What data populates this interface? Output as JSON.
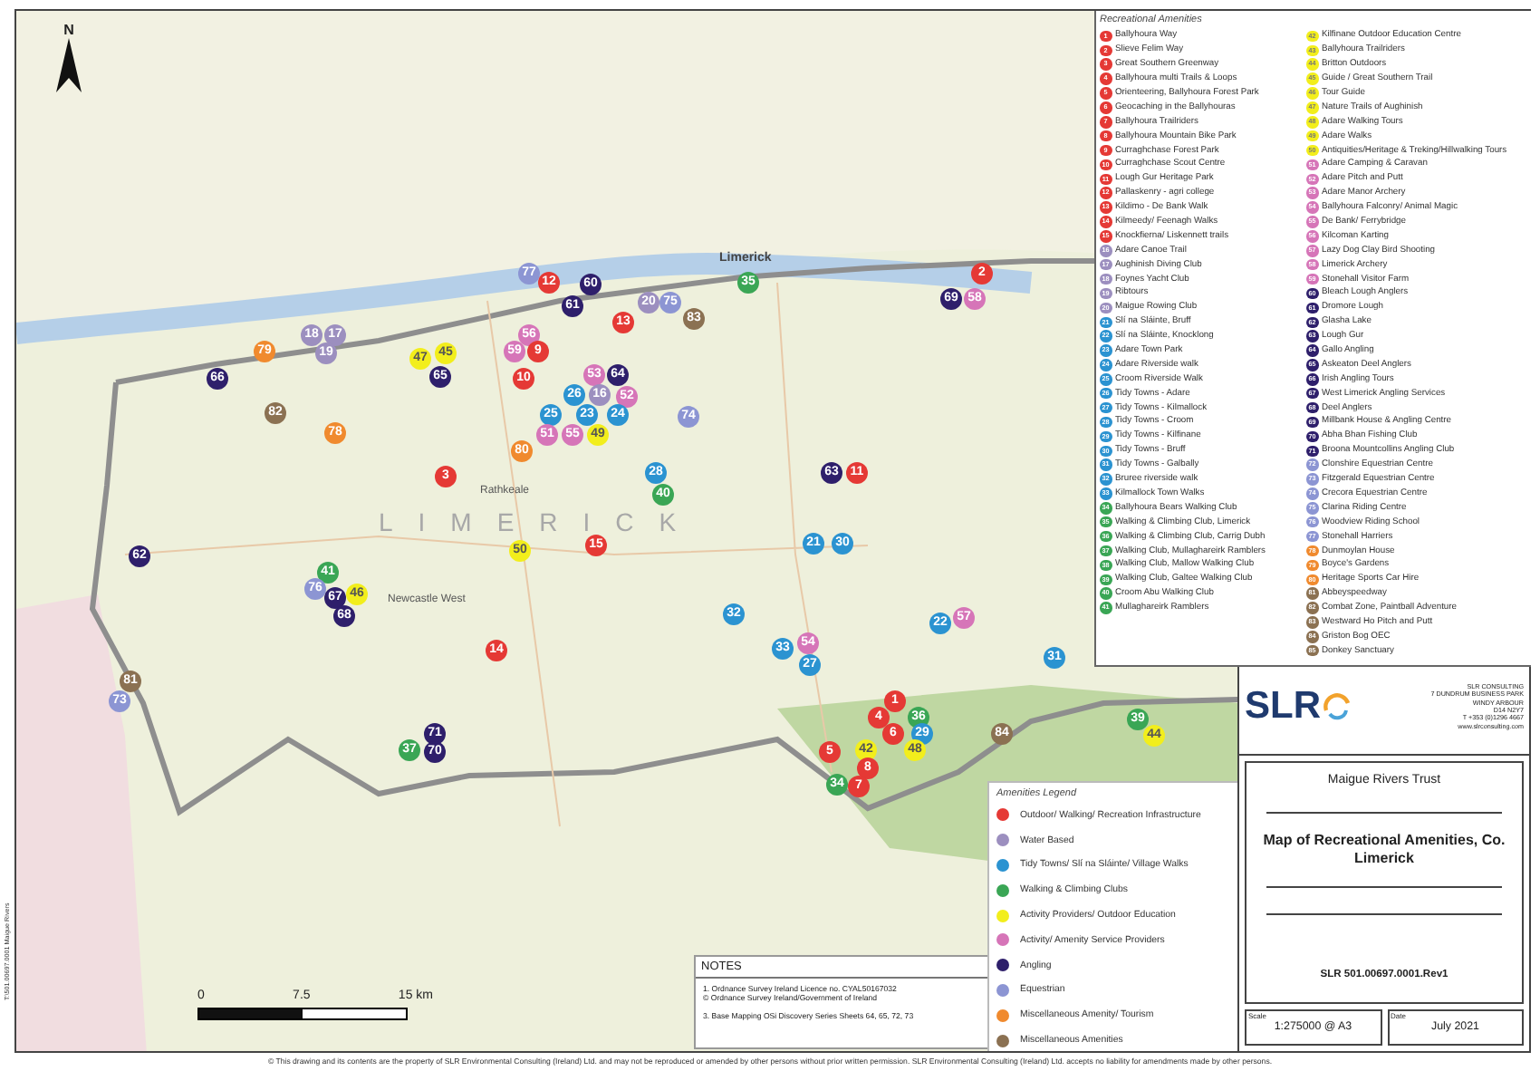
{
  "map": {
    "north_label": "N",
    "county_label": "LIMERICK",
    "places": [
      "Limerick",
      "Rathkeale",
      "Newcastle West"
    ],
    "pins": [
      {
        "label": "77",
        "color": "#8c95d3"
      },
      {
        "label": "12",
        "color": "#e53935"
      },
      {
        "label": "60",
        "color": "#2e1f6b"
      },
      {
        "label": "35",
        "color": "#3aa655"
      },
      {
        "label": "2",
        "color": "#e53935"
      },
      {
        "label": "61",
        "color": "#2e1f6b"
      },
      {
        "label": "20",
        "color": "#9c8fbf"
      },
      {
        "label": "75",
        "color": "#8c95d3"
      },
      {
        "label": "69",
        "color": "#2e1f6b"
      },
      {
        "label": "58",
        "color": "#d675b8"
      },
      {
        "label": "18",
        "color": "#9c8fbf"
      },
      {
        "label": "17",
        "color": "#9c8fbf"
      },
      {
        "label": "56",
        "color": "#d675b8"
      },
      {
        "label": "13",
        "color": "#e53935"
      },
      {
        "label": "83",
        "color": "#8b7152"
      },
      {
        "label": "79",
        "color": "#f08a2e"
      },
      {
        "label": "19",
        "color": "#9c8fbf"
      },
      {
        "label": "47",
        "color": "#f2ee1c"
      },
      {
        "label": "45",
        "color": "#f2ee1c"
      },
      {
        "label": "59",
        "color": "#d675b8"
      },
      {
        "label": "9",
        "color": "#e53935"
      },
      {
        "label": "66",
        "color": "#2e1f6b"
      },
      {
        "label": "65",
        "color": "#2e1f6b"
      },
      {
        "label": "10",
        "color": "#e53935"
      },
      {
        "label": "53",
        "color": "#d675b8"
      },
      {
        "label": "64",
        "color": "#2e1f6b"
      },
      {
        "label": "26",
        "color": "#2b93d1"
      },
      {
        "label": "16",
        "color": "#9c8fbf"
      },
      {
        "label": "52",
        "color": "#d675b8"
      },
      {
        "label": "82",
        "color": "#8b7152"
      },
      {
        "label": "25",
        "color": "#2b93d1"
      },
      {
        "label": "23",
        "color": "#2b93d1"
      },
      {
        "label": "24",
        "color": "#2b93d1"
      },
      {
        "label": "74",
        "color": "#8c95d3"
      },
      {
        "label": "78",
        "color": "#f08a2e"
      },
      {
        "label": "51",
        "color": "#d675b8"
      },
      {
        "label": "55",
        "color": "#d675b8"
      },
      {
        "label": "49",
        "color": "#f2ee1c"
      },
      {
        "label": "80",
        "color": "#f08a2e"
      },
      {
        "label": "3",
        "color": "#e53935"
      },
      {
        "label": "28",
        "color": "#2b93d1"
      },
      {
        "label": "63",
        "color": "#2e1f6b"
      },
      {
        "label": "11",
        "color": "#e53935"
      },
      {
        "label": "40",
        "color": "#3aa655"
      },
      {
        "label": "62",
        "color": "#2e1f6b"
      },
      {
        "label": "50",
        "color": "#f2ee1c"
      },
      {
        "label": "15",
        "color": "#e53935"
      },
      {
        "label": "21",
        "color": "#2b93d1"
      },
      {
        "label": "30",
        "color": "#2b93d1"
      },
      {
        "label": "41",
        "color": "#3aa655"
      },
      {
        "label": "76",
        "color": "#8c95d3"
      },
      {
        "label": "67",
        "color": "#2e1f6b"
      },
      {
        "label": "46",
        "color": "#f2ee1c"
      },
      {
        "label": "68",
        "color": "#2e1f6b"
      },
      {
        "label": "32",
        "color": "#2b93d1"
      },
      {
        "label": "22",
        "color": "#2b93d1"
      },
      {
        "label": "57",
        "color": "#d675b8"
      },
      {
        "label": "14",
        "color": "#e53935"
      },
      {
        "label": "33",
        "color": "#2b93d1"
      },
      {
        "label": "54",
        "color": "#d675b8"
      },
      {
        "label": "27",
        "color": "#2b93d1"
      },
      {
        "label": "31",
        "color": "#2b93d1"
      },
      {
        "label": "81",
        "color": "#8b7152"
      },
      {
        "label": "73",
        "color": "#8c95d3"
      },
      {
        "label": "1",
        "color": "#e53935"
      },
      {
        "label": "4",
        "color": "#e53935"
      },
      {
        "label": "36",
        "color": "#3aa655"
      },
      {
        "label": "39",
        "color": "#3aa655"
      },
      {
        "label": "71",
        "color": "#2e1f6b"
      },
      {
        "label": "6",
        "color": "#e53935"
      },
      {
        "label": "29",
        "color": "#2b93d1"
      },
      {
        "label": "84",
        "color": "#8b7152"
      },
      {
        "label": "44",
        "color": "#f2ee1c"
      },
      {
        "label": "37",
        "color": "#3aa655"
      },
      {
        "label": "70",
        "color": "#2e1f6b"
      },
      {
        "label": "5",
        "color": "#e53935"
      },
      {
        "label": "42",
        "color": "#f2ee1c"
      },
      {
        "label": "48",
        "color": "#f2ee1c"
      },
      {
        "label": "8",
        "color": "#e53935"
      },
      {
        "label": "34",
        "color": "#3aa655"
      },
      {
        "label": "7",
        "color": "#e53935"
      }
    ],
    "scale_labels": [
      "0",
      "7.5",
      "15 km"
    ]
  },
  "amenities": {
    "title": "Recreational Amenities",
    "items": [
      {
        "number": "1",
        "name": "Ballyhoura Way",
        "color": "#e53935"
      },
      {
        "number": "2",
        "name": "Slieve Felim Way",
        "color": "#e53935"
      },
      {
        "number": "3",
        "name": "Great Southern Greenway",
        "color": "#e53935"
      },
      {
        "number": "4",
        "name": "Ballyhoura multi Trails & Loops",
        "color": "#e53935"
      },
      {
        "number": "5",
        "name": "Orienteering, Ballyhoura Forest Park",
        "color": "#e53935"
      },
      {
        "number": "6",
        "name": "Geocaching in the Ballyhouras",
        "color": "#e53935"
      },
      {
        "number": "7",
        "name": "Ballyhoura Trailriders",
        "color": "#e53935"
      },
      {
        "number": "8",
        "name": "Ballyhoura Mountain Bike Park",
        "color": "#e53935"
      },
      {
        "number": "9",
        "name": "Curraghchase Forest Park",
        "color": "#e53935"
      },
      {
        "number": "10",
        "name": "Curraghchase Scout Centre",
        "color": "#e53935"
      },
      {
        "number": "11",
        "name": "Lough Gur Heritage Park",
        "color": "#e53935"
      },
      {
        "number": "12",
        "name": "Pallaskenry - agri college",
        "color": "#e53935"
      },
      {
        "number": "13",
        "name": "Kildimo - De Bank Walk",
        "color": "#e53935"
      },
      {
        "number": "14",
        "name": "Kilmeedy/ Feenagh Walks",
        "color": "#e53935"
      },
      {
        "number": "15",
        "name": "Knockfierna/ Liskennett trails",
        "color": "#e53935"
      },
      {
        "number": "16",
        "name": "Adare Canoe Trail",
        "color": "#9c8fbf"
      },
      {
        "number": "17",
        "name": "Aughinish Diving Club",
        "color": "#9c8fbf"
      },
      {
        "number": "18",
        "name": "Foynes Yacht Club",
        "color": "#9c8fbf"
      },
      {
        "number": "19",
        "name": "Ribtours",
        "color": "#9c8fbf"
      },
      {
        "number": "20",
        "name": "Maigue Rowing Club",
        "color": "#9c8fbf"
      },
      {
        "number": "21",
        "name": "Slí na Sláinte, Bruff",
        "color": "#2b93d1"
      },
      {
        "number": "22",
        "name": "Slí na Sláinte, Knocklong",
        "color": "#2b93d1"
      },
      {
        "number": "23",
        "name": "Adare Town Park",
        "color": "#2b93d1"
      },
      {
        "number": "24",
        "name": "Adare Riverside walk",
        "color": "#2b93d1"
      },
      {
        "number": "25",
        "name": "Croom Riverside Walk",
        "color": "#2b93d1"
      },
      {
        "number": "26",
        "name": "Tidy Towns - Adare",
        "color": "#2b93d1"
      },
      {
        "number": "27",
        "name": "Tidy Towns - Kilmallock",
        "color": "#2b93d1"
      },
      {
        "number": "28",
        "name": "Tidy Towns - Croom",
        "color": "#2b93d1"
      },
      {
        "number": "29",
        "name": "Tidy Towns - Kilfinane",
        "color": "#2b93d1"
      },
      {
        "number": "30",
        "name": "Tidy Towns - Bruff",
        "color": "#2b93d1"
      },
      {
        "number": "31",
        "name": "Tidy Towns - Galbally",
        "color": "#2b93d1"
      },
      {
        "number": "32",
        "name": "Bruree riverside walk",
        "color": "#2b93d1"
      },
      {
        "number": "33",
        "name": "Kilmallock Town Walks",
        "color": "#2b93d1"
      },
      {
        "number": "34",
        "name": "Ballyhoura Bears Walking Club",
        "color": "#3aa655"
      },
      {
        "number": "35",
        "name": "Walking & Climbing Club, Limerick",
        "color": "#3aa655"
      },
      {
        "number": "36",
        "name": "Walking & Climbing Club, Carrig Dubh",
        "color": "#3aa655"
      },
      {
        "number": "37",
        "name": "Walking Club, Mullaghareirk Ramblers",
        "color": "#3aa655"
      },
      {
        "number": "38",
        "name": "Walking Club, Mallow Walking Club",
        "color": "#3aa655"
      },
      {
        "number": "39",
        "name": "Walking Club, Galtee Walking Club",
        "color": "#3aa655"
      },
      {
        "number": "40",
        "name": "Croom Abu Walking Club",
        "color": "#3aa655"
      },
      {
        "number": "41",
        "name": "Mullaghareirk Ramblers",
        "color": "#3aa655"
      },
      {
        "number": "42",
        "name": "Kilfinane Outdoor Education Centre",
        "color": "#f2ee1c"
      },
      {
        "number": "43",
        "name": "Ballyhoura Trailriders",
        "color": "#f2ee1c"
      },
      {
        "number": "44",
        "name": "Britton Outdoors",
        "color": "#f2ee1c"
      },
      {
        "number": "45",
        "name": "Guide / Great Southern Trail",
        "color": "#f2ee1c"
      },
      {
        "number": "46",
        "name": "Tour Guide",
        "color": "#f2ee1c"
      },
      {
        "number": "47",
        "name": "Nature Trails of Aughinish",
        "color": "#f2ee1c"
      },
      {
        "number": "48",
        "name": "Adare Walking Tours",
        "color": "#f2ee1c"
      },
      {
        "number": "49",
        "name": "Adare Walks",
        "color": "#f2ee1c"
      },
      {
        "number": "50",
        "name": "Antiquities/Heritage & Treking/Hillwalking Tours",
        "color": "#f2ee1c"
      },
      {
        "number": "51",
        "name": "Adare Camping & Caravan",
        "color": "#d675b8"
      },
      {
        "number": "52",
        "name": "Adare Pitch and Putt",
        "color": "#d675b8"
      },
      {
        "number": "53",
        "name": "Adare Manor Archery",
        "color": "#d675b8"
      },
      {
        "number": "54",
        "name": "Ballyhoura Falconry/ Animal Magic",
        "color": "#d675b8"
      },
      {
        "number": "55",
        "name": "De Bank/ Ferrybridge",
        "color": "#d675b8"
      },
      {
        "number": "56",
        "name": "Kilcoman Karting",
        "color": "#d675b8"
      },
      {
        "number": "57",
        "name": "Lazy Dog Clay Bird Shooting",
        "color": "#d675b8"
      },
      {
        "number": "58",
        "name": "Limerick Archery",
        "color": "#d675b8"
      },
      {
        "number": "59",
        "name": "Stonehall Visitor Farm",
        "color": "#d675b8"
      },
      {
        "number": "60",
        "name": "Bleach Lough Anglers",
        "color": "#2e1f6b"
      },
      {
        "number": "61",
        "name": "Dromore Lough",
        "color": "#2e1f6b"
      },
      {
        "number": "62",
        "name": "Glasha Lake",
        "color": "#2e1f6b"
      },
      {
        "number": "63",
        "name": "Lough Gur",
        "color": "#2e1f6b"
      },
      {
        "number": "64",
        "name": "Gallo Angling",
        "color": "#2e1f6b"
      },
      {
        "number": "65",
        "name": "Askeaton Deel Anglers",
        "color": "#2e1f6b"
      },
      {
        "number": "66",
        "name": "Irish Angling Tours",
        "color": "#2e1f6b"
      },
      {
        "number": "67",
        "name": "West Limerick Angling Services",
        "color": "#2e1f6b"
      },
      {
        "number": "68",
        "name": "Deel Anglers",
        "color": "#2e1f6b"
      },
      {
        "number": "69",
        "name": "Millbank House & Angling Centre",
        "color": "#2e1f6b"
      },
      {
        "number": "70",
        "name": "Abha Bhan Fishing Club",
        "color": "#2e1f6b"
      },
      {
        "number": "71",
        "name": "Broona Mountcollins Angling Club",
        "color": "#2e1f6b"
      },
      {
        "number": "72",
        "name": "Clonshire Equestrian Centre",
        "color": "#8c95d3"
      },
      {
        "number": "73",
        "name": "Fitzgerald Equestrian Centre",
        "color": "#8c95d3"
      },
      {
        "number": "74",
        "name": "Crecora Equestrian Centre",
        "color": "#8c95d3"
      },
      {
        "number": "75",
        "name": "Clarina Riding Centre",
        "color": "#8c95d3"
      },
      {
        "number": "76",
        "name": "Woodview Riding School",
        "color": "#8c95d3"
      },
      {
        "number": "77",
        "name": "Stonehall Harriers",
        "color": "#8c95d3"
      },
      {
        "number": "78",
        "name": "Dunmoylan House",
        "color": "#f08a2e"
      },
      {
        "number": "79",
        "name": "Boyce's Gardens",
        "color": "#f08a2e"
      },
      {
        "number": "80",
        "name": "Heritage Sports Car Hire",
        "color": "#f08a2e"
      },
      {
        "number": "81",
        "name": "Abbeyspeedway",
        "color": "#8b7152"
      },
      {
        "number": "82",
        "name": "Combat Zone, Paintball Adventure",
        "color": "#8b7152"
      },
      {
        "number": "83",
        "name": "Westward Ho Pitch and Putt",
        "color": "#8b7152"
      },
      {
        "number": "84",
        "name": "Griston Bog OEC",
        "color": "#8b7152"
      },
      {
        "number": "85",
        "name": "Donkey Sanctuary",
        "color": "#8b7152"
      }
    ]
  },
  "legend": {
    "title": "Amenities Legend",
    "items": [
      {
        "label": "Outdoor/ Walking/  Recreation Infrastructure",
        "color": "#e53935"
      },
      {
        "label": "Water Based",
        "color": "#9c8fbf"
      },
      {
        "label": "Tidy Towns/ Slí na Sláinte/ Village  Walks",
        "color": "#2b93d1"
      },
      {
        "label": "Walking & Climbing Clubs",
        "color": "#3aa655"
      },
      {
        "label": "Activity Providers/ Outdoor Education",
        "color": "#f2ee1c"
      },
      {
        "label": "Activity/ Amenity Service Providers",
        "color": "#d675b8"
      },
      {
        "label": "Angling",
        "color": "#2e1f6b"
      },
      {
        "label": "Equestrian",
        "color": "#8c95d3"
      },
      {
        "label": "Miscellaneous Amenity/ Tourism",
        "color": "#f08a2e"
      },
      {
        "label": "Miscellaneous Amenities",
        "color": "#8b7152"
      }
    ]
  },
  "notes": {
    "title": "NOTES",
    "lines": [
      "1. Ordnance Survey Ireland Licence no. CYAL50167032",
      "© Ordnance Survey Ireland/Government of Ireland",
      "3. Base Mapping OSi Discovery Series Sheets 64, 65, 72, 73"
    ]
  },
  "title_block": {
    "logo": "SLR",
    "address": [
      "SLR CONSULTING",
      "7 DUNDRUM BUSINESS PARK",
      "WINDY ARBOUR",
      "D14 N2Y7",
      "T +353 (0)1296 4667",
      "www.slrconsulting.com"
    ],
    "client": "Maigue Rivers Trust",
    "title": "Map of Recreational Amenities, Co. Limerick",
    "drawing_number": "SLR 501.00697.0001.Rev1",
    "scale_label": "Scale",
    "scale": "1:275000 @ A3",
    "date_label": "Date",
    "date": "July 2021"
  },
  "side_text": "T:\\501.00697.0001 Maigue Rivers",
  "footer": "© This drawing and its contents are the property of SLR Environmental Consulting (Ireland) Ltd. and may not be reproduced or amended by other persons without prior written permission. SLR Environmental Consulting (Ireland) Ltd. accepts no liability for amendments made by other persons."
}
